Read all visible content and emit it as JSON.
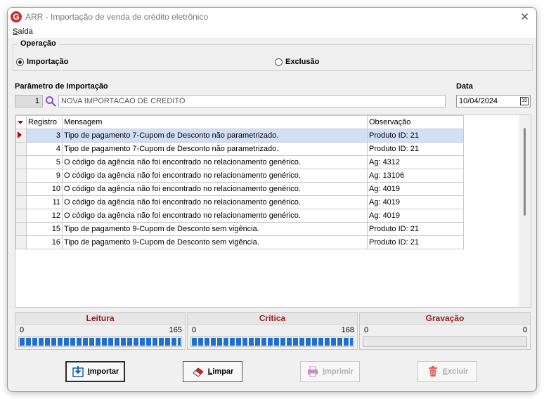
{
  "window": {
    "logo_letter": "G",
    "title": "ARR - Importação de venda de crédito eletrônico",
    "close_glyph": "✕"
  },
  "menu": {
    "saida_first": "S",
    "saida_rest": "aída"
  },
  "operacao": {
    "legend": "Operação",
    "options": [
      {
        "label": "Importação",
        "selected": true
      },
      {
        "label": "Exclusão",
        "selected": false
      }
    ]
  },
  "parametro": {
    "label": "Parâmetro de Importação",
    "code": "1",
    "description": "NOVA IMPORTACAO DE CREDITO"
  },
  "data": {
    "label": "Data",
    "value": "10/04/2024",
    "calendar_icon_text": "15"
  },
  "grid": {
    "headers": [
      "Registro",
      "Mensagem",
      "Observação"
    ],
    "rows": [
      {
        "registro": "3",
        "mensagem": "Tipo de pagamento 7-Cupom de Desconto não parametrizado.",
        "observacao": "Produto ID: 21"
      },
      {
        "registro": "4",
        "mensagem": "Tipo de pagamento 7-Cupom de Desconto não parametrizado.",
        "observacao": "Produto ID: 21"
      },
      {
        "registro": "5",
        "mensagem": "O código da agência não foi encontrado no relacionamento genérico.",
        "observacao": "Ag: 4312"
      },
      {
        "registro": "9",
        "mensagem": "O código da agência não foi encontrado no relacionamento genérico.",
        "observacao": "Ag: 13106"
      },
      {
        "registro": "10",
        "mensagem": "O código da agência não foi encontrado no relacionamento genérico.",
        "observacao": "Ag: 4019"
      },
      {
        "registro": "11",
        "mensagem": "O código da agência não foi encontrado no relacionamento genérico.",
        "observacao": "Ag: 4019"
      },
      {
        "registro": "12",
        "mensagem": "O código da agência não foi encontrado no relacionamento genérico.",
        "observacao": "Ag: 4019"
      },
      {
        "registro": "15",
        "mensagem": "Tipo de pagamento 9-Cupom de Desconto sem vigência.",
        "observacao": "Produto ID: 21"
      },
      {
        "registro": "16",
        "mensagem": "Tipo de pagamento 9-Cupom de Desconto sem vigência.",
        "observacao": "Produto ID: 21"
      }
    ]
  },
  "progress": [
    {
      "title": "Leitura",
      "min": "0",
      "max": "165",
      "fraction": 1.0
    },
    {
      "title": "Crítica",
      "min": "0",
      "max": "168",
      "fraction": 1.0
    },
    {
      "title": "Gravação",
      "min": "0",
      "max": "0",
      "fraction": 0.0
    }
  ],
  "buttons": {
    "importar": {
      "first": "I",
      "rest": "mportar",
      "enabled": true
    },
    "limpar": {
      "first": "L",
      "rest": "impar",
      "enabled": true
    },
    "imprimir": {
      "first": "I",
      "rest": "mprimir",
      "enabled": false
    },
    "excluir": {
      "first": "E",
      "rest": "xcluir",
      "enabled": false
    }
  },
  "colors": {
    "accent_red": "#c00000",
    "progress_title": "#9b1c1c",
    "progress_fill": "#1f6fcf",
    "selected_row": "#cfe0f7"
  }
}
